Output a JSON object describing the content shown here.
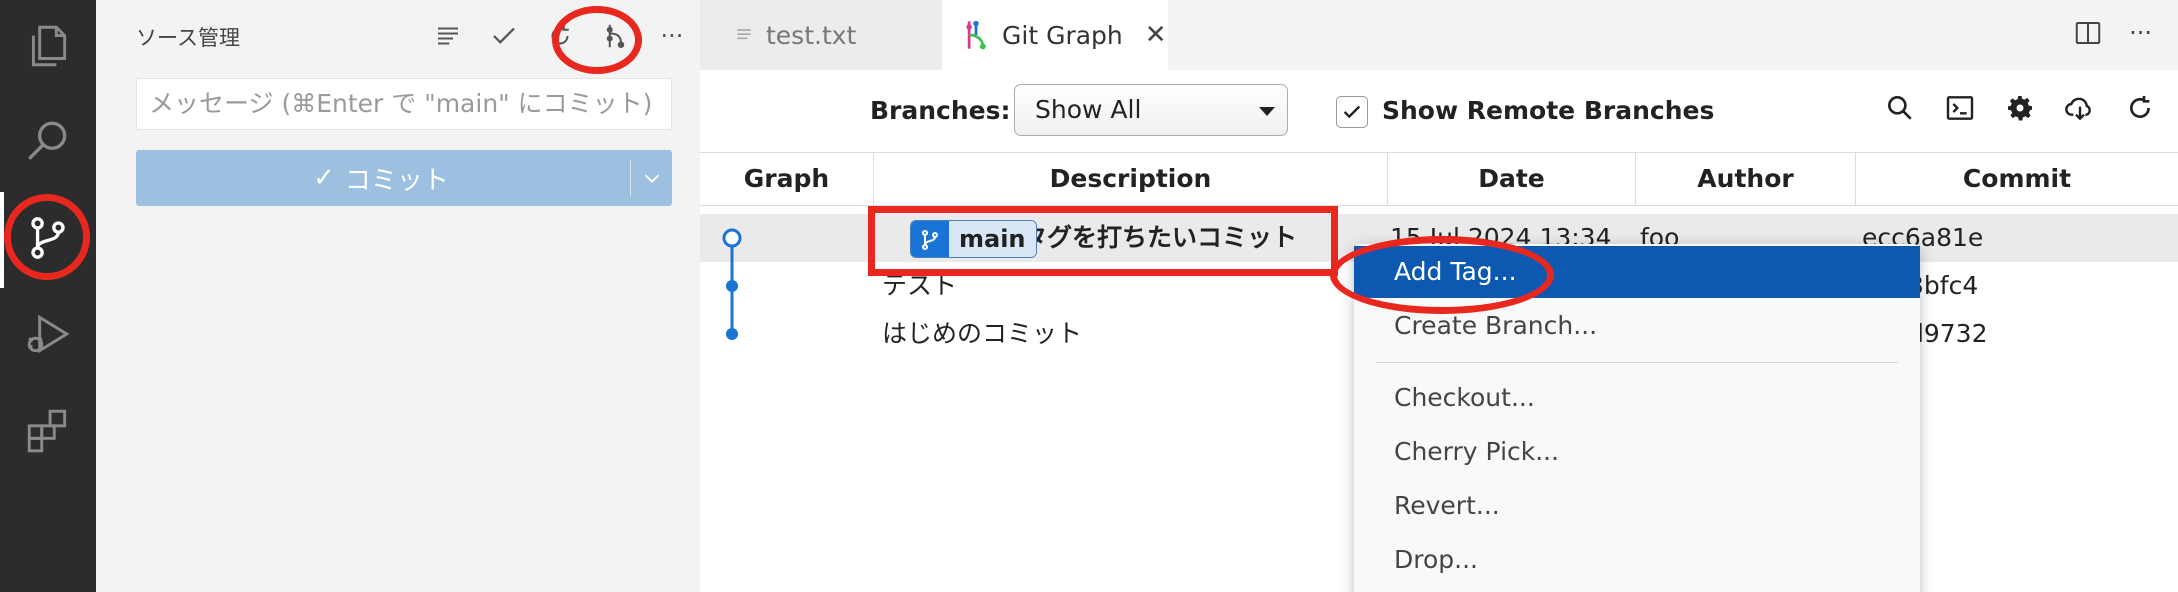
{
  "sidebar": {
    "title": "ソース管理",
    "message_placeholder": "メッセージ (⌘Enter で \"main\" にコミット)",
    "commit_label": "コミット",
    "commit_check": "✓"
  },
  "tabs": [
    {
      "label": "test.txt",
      "active": false
    },
    {
      "label": "Git Graph",
      "active": true
    }
  ],
  "tab_close": "✕",
  "editor_actions_more": "···",
  "sidebar_more": "···",
  "toolbar": {
    "branches_label": "Branches:",
    "branches_value": "Show All",
    "show_remote_label": "Show Remote Branches",
    "show_remote_checked": true
  },
  "table": {
    "columns": [
      "Graph",
      "Description",
      "Date",
      "Author",
      "Commit"
    ],
    "rows": [
      {
        "description": "タグを打ちたいコミット",
        "date": "15 Jul 2024 13:34",
        "author": "foo",
        "commit": "ecc6a81e",
        "ref": "main",
        "selected": true
      },
      {
        "description": "テスト",
        "date": "",
        "author": "",
        "commit": "3bfc4",
        "ref": "",
        "selected": false
      },
      {
        "description": "はじめのコミット",
        "date": "",
        "author": "",
        "commit": "d9732",
        "ref": "",
        "selected": false
      }
    ]
  },
  "context_menu": {
    "items": [
      {
        "label": "Add Tag...",
        "highlighted": true
      },
      {
        "label": "Create Branch...",
        "highlighted": false
      },
      {
        "label": "Checkout...",
        "highlighted": false
      },
      {
        "label": "Cherry Pick...",
        "highlighted": false
      },
      {
        "label": "Revert...",
        "highlighted": false
      },
      {
        "label": "Drop...",
        "highlighted": false
      }
    ]
  },
  "colors": {
    "accent": "#1a74d8",
    "menu_highlight": "#0d59b2",
    "annotation": "#e8281e",
    "graph_line": "#1a74d8"
  },
  "icons": {
    "activity": [
      "files-icon",
      "search-icon",
      "source-control-icon",
      "run-debug-icon",
      "extensions-icon"
    ],
    "sidebar_actions": [
      "view-as-list-icon",
      "commit-check-icon",
      "refresh-icon",
      "git-graph-icon",
      "more-icon"
    ],
    "toolbar": [
      "find-icon",
      "terminal-icon",
      "settings-icon",
      "fetch-icon",
      "refresh-icon"
    ]
  }
}
